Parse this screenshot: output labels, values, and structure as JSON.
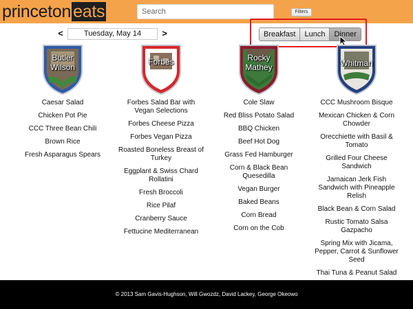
{
  "header": {
    "logo_part1": "princeton",
    "logo_part2": "eats",
    "search_placeholder": "Search",
    "filters_label": "Filters"
  },
  "date_nav": {
    "prev": "<",
    "date": "Tuesday, May 14",
    "next": ">"
  },
  "meals": {
    "breakfast": "Breakfast",
    "lunch": "Lunch",
    "dinner": "Dinner",
    "active": "Dinner"
  },
  "halls": [
    {
      "name_line1": "Butler",
      "name_line2": "Wilson",
      "crest_icon": "butler-wilson-crest-icon",
      "color": "#2f5aa8",
      "items": [
        "Caesar Salad",
        "Chicken Pot Pie",
        "CCC Three Bean Chili",
        "Brown Rice",
        "Fresh Asparagus Spears"
      ]
    },
    {
      "name_line1": "Forbes",
      "name_line2": "",
      "crest_icon": "forbes-crest-icon",
      "color": "#d8262b",
      "items": [
        "Forbes Salad Bar with Vegan Selections",
        "Forbes Cheese Pizza",
        "Forbes Vegan Pizza",
        "Roasted Boneless Breast of Turkey",
        "Eggplant & Swiss Chard Rollatini",
        "Fresh Broccoli",
        "Rice Pilaf",
        "Cranberry Sauce",
        "Fettucine Mediterranean"
      ]
    },
    {
      "name_line1": "Rocky",
      "name_line2": "Mathey",
      "crest_icon": "rocky-mathey-crest-icon",
      "color": "#8c1c2c",
      "items": [
        "Cole Slaw",
        "Red Bliss Potato Salad",
        "BBQ Chicken",
        "Beef Hot Dog",
        "Grass Fed Hamburger",
        "Corn & Black Bean Quesedilla",
        "Vegan Burger",
        "Baked Beans",
        "Corn Bread",
        "Corn on the Cob"
      ]
    },
    {
      "name_line1": "Whitman",
      "name_line2": "",
      "crest_icon": "whitman-crest-icon",
      "color": "#23407f",
      "items": [
        "CCC Mushroom Bisque",
        "Mexican Chicken & Corn Chowder",
        "Orecchiette with Basil & Tomato",
        "Grilled Four Cheese Sandwich",
        "Jamaican Jerk Fish Sandwich with Pineapple Relish",
        "Black Bean & Corn Salad",
        "Rustic Tomato Salsa Gazpacho",
        "Spring Mix with Jicama, Pepper, Carrot & Sunflower Seed",
        "Thai Tuna & Peanut Salad"
      ]
    }
  ],
  "footer": {
    "text": "© 2013 Sam Gavis-Hughson, Will Gwozdz, David Lackey, George Okeowo"
  },
  "colors": {
    "header_bg": "#f5a34a",
    "logo_box_bg": "#1f1f1f",
    "highlight_border": "#e21b1b",
    "footer_bg": "#000000"
  }
}
